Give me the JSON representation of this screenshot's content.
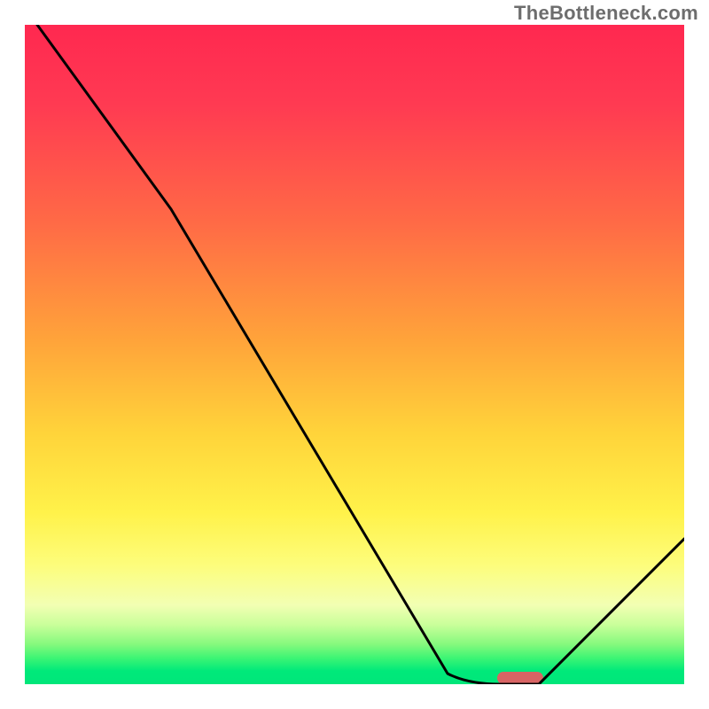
{
  "watermark": "TheBottleneck.com",
  "chart_data": {
    "type": "line",
    "title": "",
    "xlabel": "",
    "ylabel": "",
    "xlim": [
      0,
      100
    ],
    "ylim": [
      0,
      100
    ],
    "x": [
      2,
      22,
      64,
      72,
      78,
      100
    ],
    "values": [
      100,
      72,
      1,
      0,
      0,
      22
    ],
    "marker": {
      "x": 75,
      "y": 0,
      "color": "#d86464"
    },
    "background": "red-yellow-green vertical gradient",
    "grid": false,
    "legend": false
  }
}
